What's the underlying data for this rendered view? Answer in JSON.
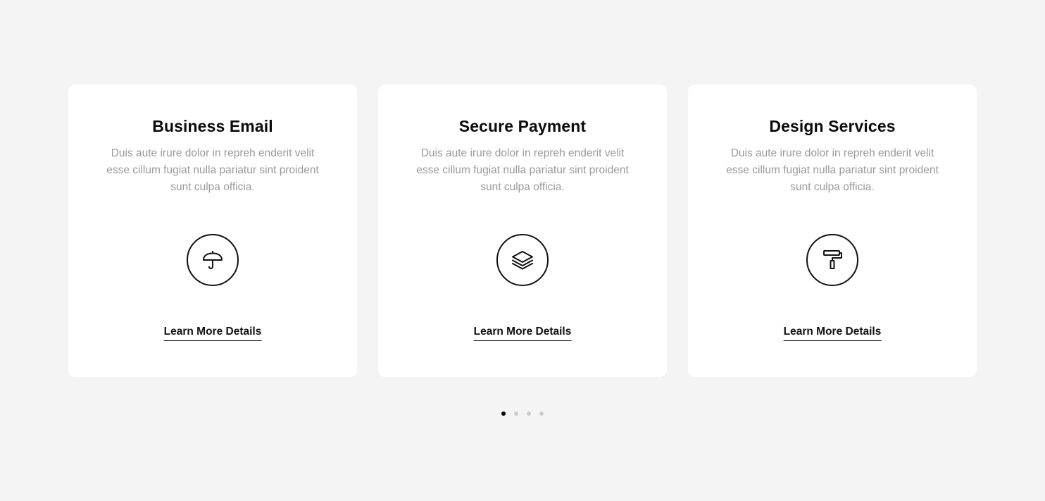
{
  "cards": [
    {
      "title": "Business Email",
      "description": "Duis aute irure dolor in repreh enderit velit esse cillum fugiat nulla pariatur sint proident sunt culpa officia.",
      "icon": "umbrella-icon",
      "link_label": "Learn More Details"
    },
    {
      "title": "Secure Payment",
      "description": "Duis aute irure dolor in repreh enderit velit esse cillum fugiat nulla pariatur sint proident sunt culpa officia.",
      "icon": "layers-icon",
      "link_label": "Learn More Details"
    },
    {
      "title": "Design Services",
      "description": "Duis aute irure dolor in repreh enderit velit esse cillum fugiat nulla pariatur sint proident sunt culpa officia.",
      "icon": "paint-roller-icon",
      "link_label": "Learn More Details"
    }
  ],
  "pagination": {
    "total": 4,
    "active": 1
  },
  "colors": {
    "page_background": "#f4f4f4",
    "card_background": "#ffffff",
    "title": "#0b0b0b",
    "description": "#9a9a9a",
    "dot_active": "#000000",
    "dot_inactive": "#cccccc"
  }
}
